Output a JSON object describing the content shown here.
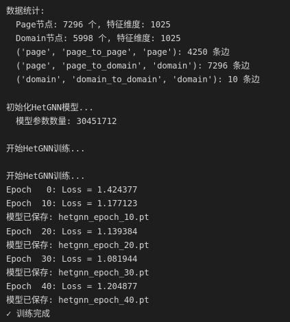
{
  "terminal": {
    "stats_header": "数据统计:",
    "page_nodes": "Page节点: 7296 个, 特征维度: 1025",
    "domain_nodes": "Domain节点: 5998 个, 特征维度: 1025",
    "edge_page_page": "('page', 'page_to_page', 'page'): 4250 条边",
    "edge_page_domain": "('page', 'page_to_domain', 'domain'): 7296 条边",
    "edge_domain_domain": "('domain', 'domain_to_domain', 'domain'): 10 条边",
    "init_model": "初始化HetGNN模型...",
    "param_count": "模型参数数量: 30451712",
    "start_training_1": "开始HetGNN训练...",
    "start_training_2": "开始HetGNN训练...",
    "log": [
      "Epoch   0: Loss = 1.424377",
      "Epoch  10: Loss = 1.177123",
      "模型已保存: hetgnn_epoch_10.pt",
      "Epoch  20: Loss = 1.139384",
      "模型已保存: hetgnn_epoch_20.pt",
      "Epoch  30: Loss = 1.081944",
      "模型已保存: hetgnn_epoch_30.pt",
      "Epoch  40: Loss = 1.204877",
      "模型已保存: hetgnn_epoch_40.pt"
    ],
    "done_check": "✓",
    "done_text": "训练完成"
  },
  "colors": {
    "background": "#1e1e1e",
    "text": "#d4d4d4"
  }
}
